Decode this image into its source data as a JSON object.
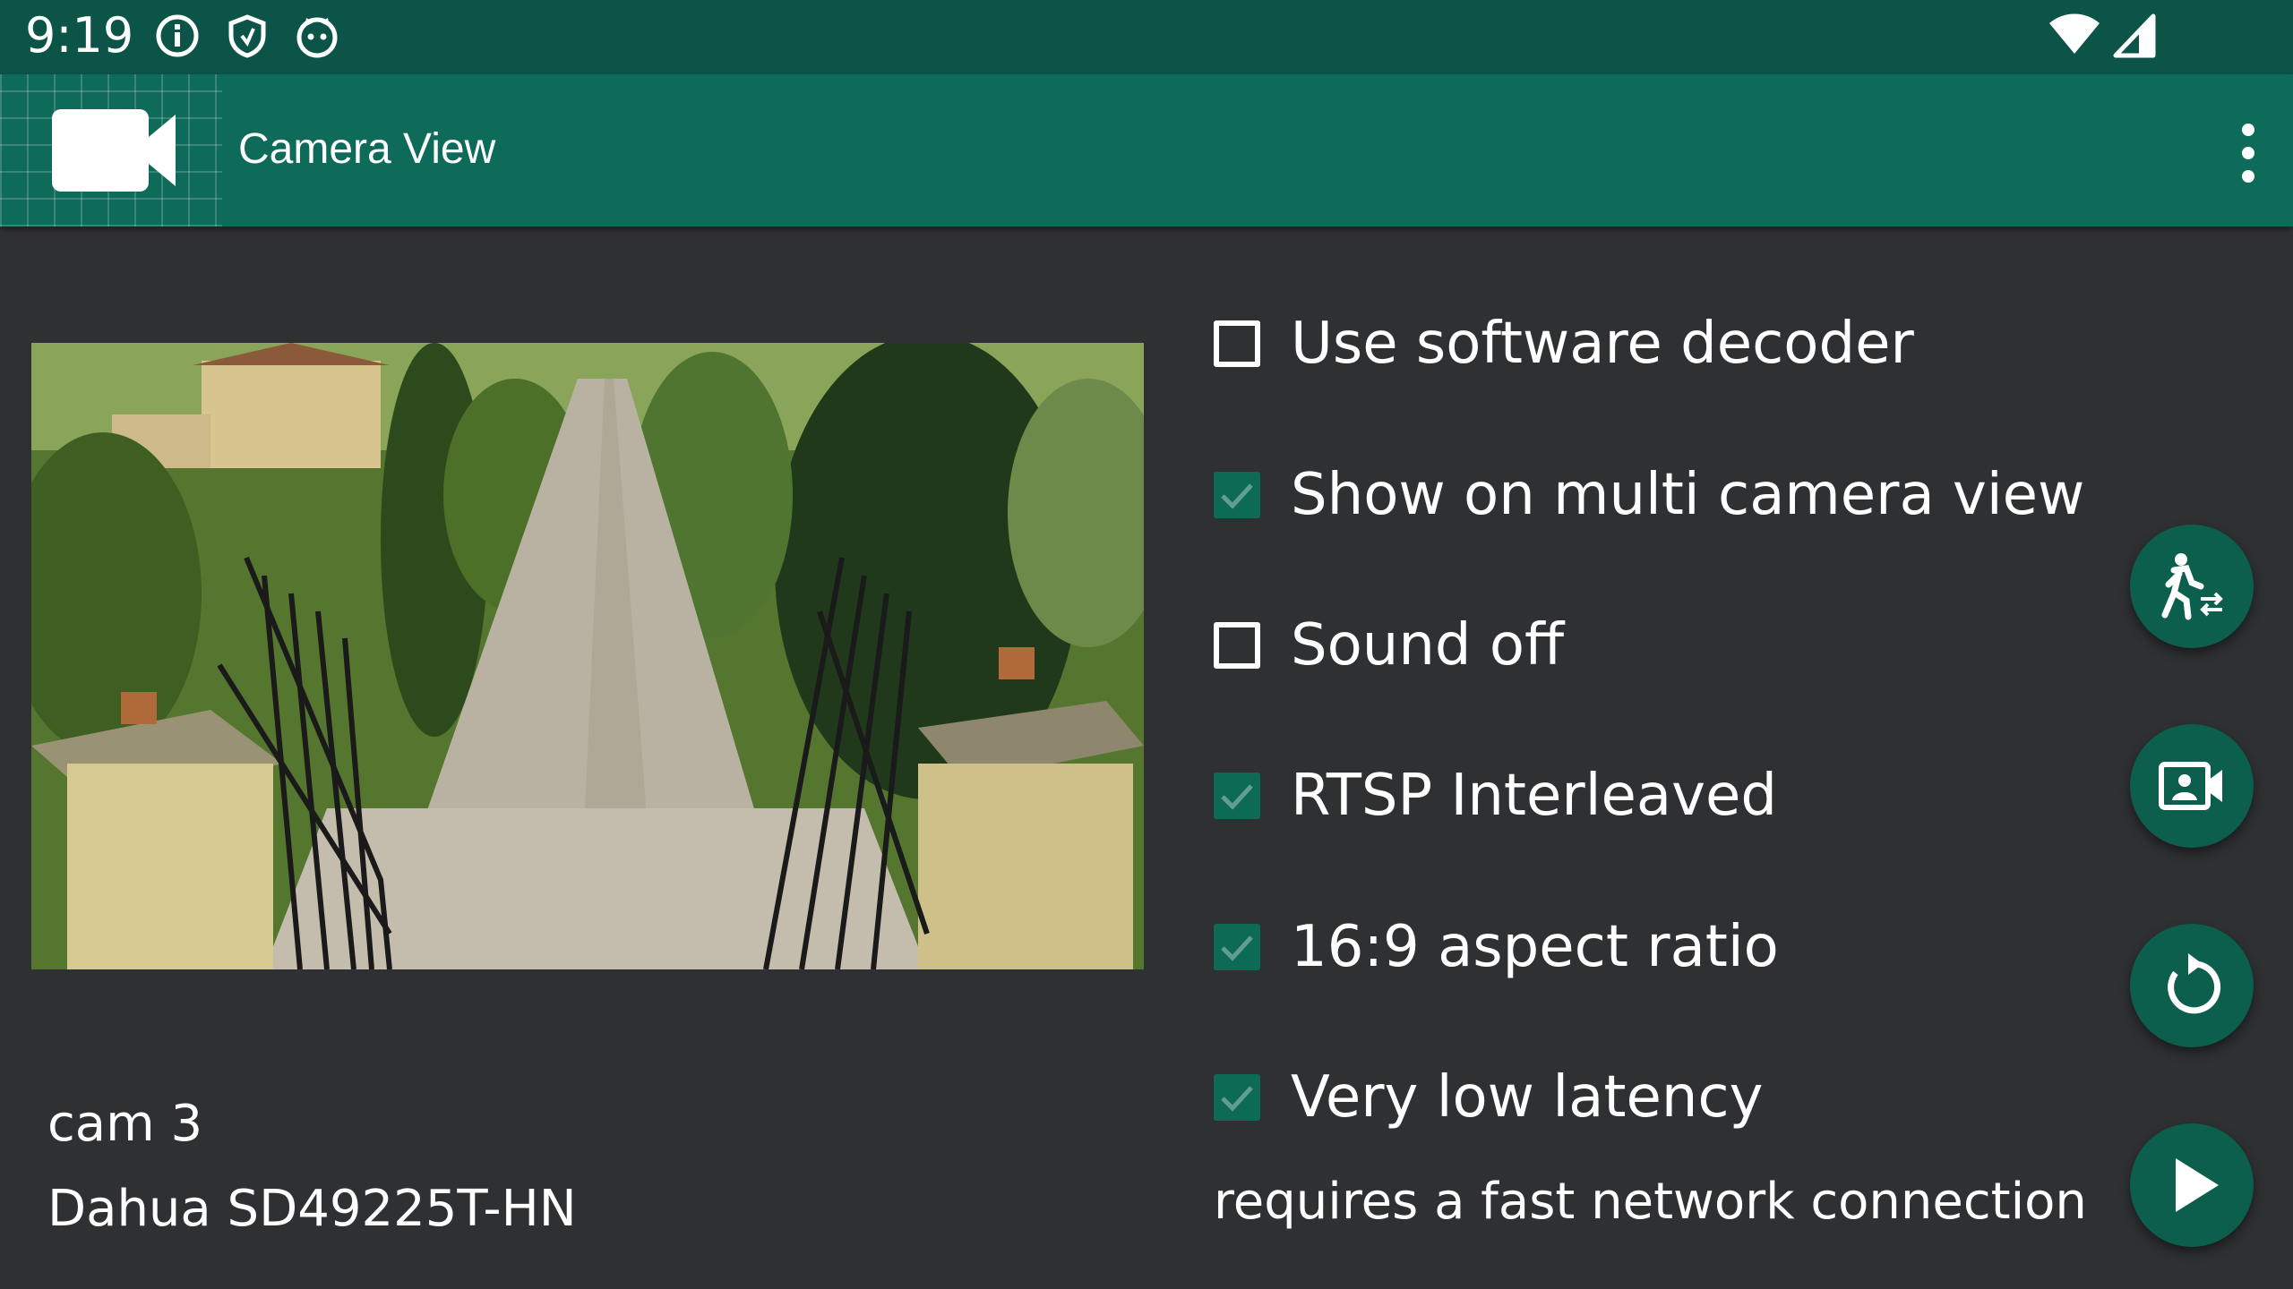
{
  "status_bar": {
    "time": "9:19",
    "left_icons": [
      "info-icon",
      "shield-icon",
      "cat-face-icon"
    ],
    "right_icons": [
      "wifi-icon",
      "signal-icon"
    ]
  },
  "app_bar": {
    "title": "Camera View",
    "logo_icon": "video-camera-icon",
    "menu_icon": "more-vert-icon"
  },
  "camera": {
    "name": "cam 3",
    "model": "Dahua SD49225T-HN"
  },
  "options": [
    {
      "label": "Use software decoder",
      "checked": false
    },
    {
      "label": "Show on multi camera view",
      "checked": true
    },
    {
      "label": "Sound off",
      "checked": false
    },
    {
      "label": "RTSP Interleaved",
      "checked": true
    },
    {
      "label": "16:9 aspect ratio",
      "checked": true
    },
    {
      "label": "Very low latency",
      "checked": true
    }
  ],
  "latency_note": "requires a fast network connection",
  "fabs": [
    "motion-detection-icon",
    "video-record-icon",
    "refresh-icon",
    "play-icon"
  ],
  "colors": {
    "status_bar": "#0c5447",
    "app_bar": "#0e6b59",
    "background": "#2f3032",
    "accent": "#0d6b55"
  }
}
